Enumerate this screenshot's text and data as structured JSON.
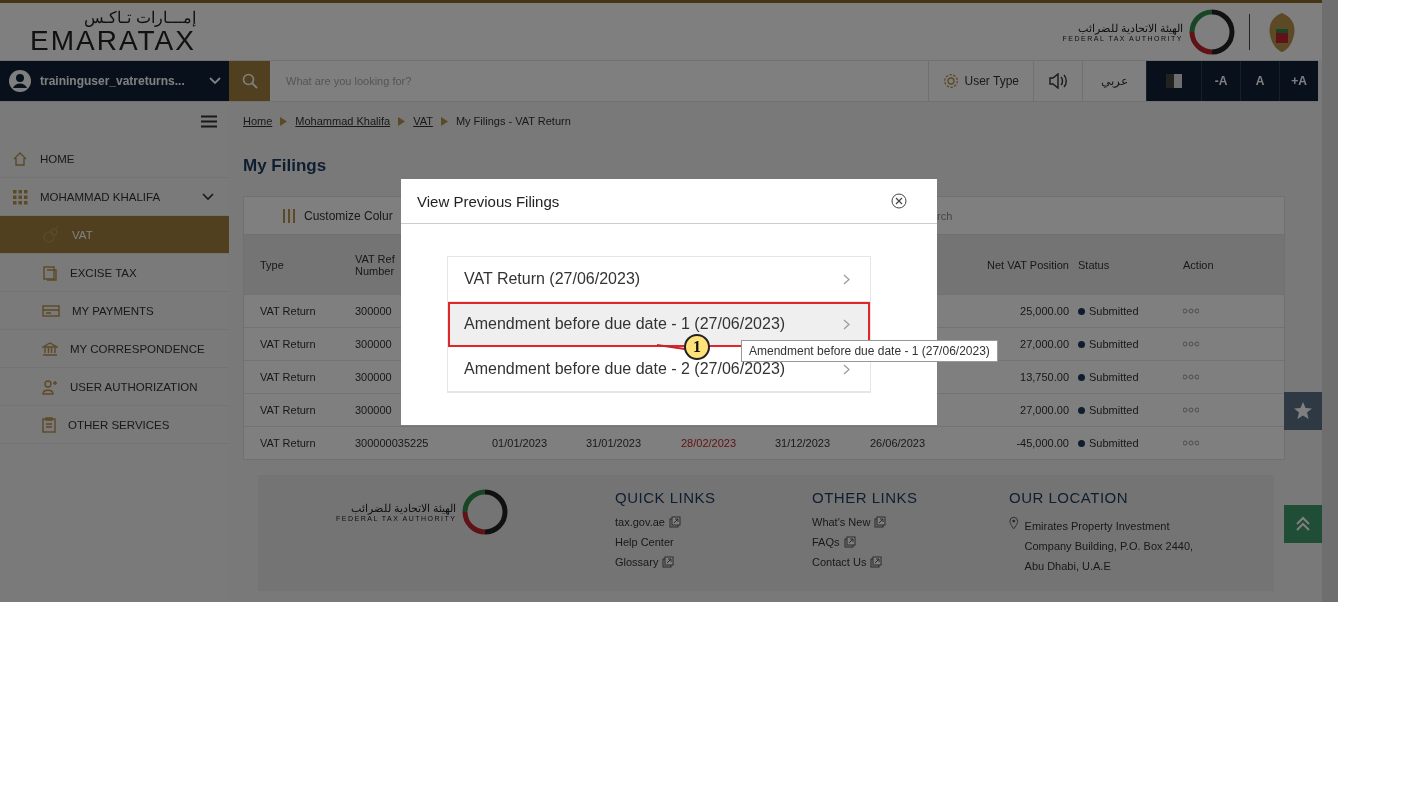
{
  "header": {
    "logo_arabic": "إمـــارات تـاكـس",
    "logo_text": "EMARATAX",
    "authority_arabic": "الهيئة الاتحادية للضرائب",
    "authority_name": "FEDERAL TAX AUTHORITY"
  },
  "navbar": {
    "user": "traininguser_vatreturns...",
    "search": {
      "placeholder": "What are you looking for?"
    },
    "user_type": "User Type",
    "language": "عربي",
    "font_buttons": [
      "-A",
      "A",
      "+A"
    ]
  },
  "breadcrumb": [
    {
      "label": "Home",
      "link": true
    },
    {
      "label": "Mohammad Khalifa",
      "link": true
    },
    {
      "label": "VAT",
      "link": true
    },
    {
      "label": "My Filings - VAT Return",
      "link": false
    }
  ],
  "sidebar": {
    "items": [
      {
        "label": "HOME",
        "selected": false
      },
      {
        "label": "MOHAMMAD KHALIFA",
        "selected": false,
        "expanded": true,
        "children": [
          {
            "label": "VAT",
            "selected": true
          },
          {
            "label": "EXCISE TAX",
            "selected": false
          },
          {
            "label": "MY PAYMENTS",
            "selected": false
          },
          {
            "label": "MY CORRESPONDENCE",
            "selected": false
          },
          {
            "label": "USER AUTHORIZATION",
            "selected": false
          },
          {
            "label": "OTHER SERVICES",
            "selected": false
          }
        ]
      }
    ]
  },
  "page_title": "My Filings",
  "table": {
    "customize": "Customize Colur",
    "search": "rch",
    "columns": [
      "Type",
      "VAT Ref Number",
      "Net VAT Position",
      "Status",
      "Action"
    ],
    "rows": [
      {
        "type": "VAT Return",
        "ref": "300000",
        "net": "25,000.00",
        "status": "Submitted"
      },
      {
        "type": "VAT Return",
        "ref": "300000",
        "net": "27,000.00",
        "status": "Submitted"
      },
      {
        "type": "VAT Return",
        "ref": "300000",
        "net": "13,750.00",
        "status": "Submitted"
      },
      {
        "type": "VAT Return",
        "ref": "300000",
        "net": "27,000.00",
        "status": "Submitted"
      },
      {
        "type": "VAT Return",
        "ref": "300000035225",
        "dates": [
          "01/01/2023",
          "31/01/2023",
          "28/02/2023",
          "31/12/2023",
          "26/06/2023"
        ],
        "due_overdue": true,
        "net": "-45,000.00",
        "status": "Submitted"
      }
    ]
  },
  "footer": {
    "authority_arabic": "الهيئة الاتحادية للضرائب",
    "authority_name": "FEDERAL TAX AUTHORITY",
    "quick_links": {
      "title": "QUICK LINKS",
      "links": [
        {
          "label": "tax.gov.ae",
          "external": true
        },
        {
          "label": "Help Center",
          "external": false
        },
        {
          "label": "Glossary",
          "external": true
        }
      ]
    },
    "other_links": {
      "title": "OTHER LINKS",
      "links": [
        {
          "label": "What's New",
          "external": true
        },
        {
          "label": "FAQs",
          "external": true
        },
        {
          "label": "Contact Us",
          "external": true
        }
      ]
    },
    "location": {
      "title": "OUR LOCATION",
      "address": "Emirates Property Investment Company Building, P.O. Box 2440, Abu Dhabi, U.A.E"
    }
  },
  "modal": {
    "title": "View Previous Filings",
    "items": [
      {
        "label": "VAT Return (27/06/2023)",
        "selected": false
      },
      {
        "label": "Amendment before due date - 1 (27/06/2023)",
        "selected": true
      },
      {
        "label": "Amendment before due date - 2 (27/06/2023)",
        "selected": false
      }
    ]
  },
  "tooltip": "Amendment before due date - 1 (27/06/2023)",
  "callout": "1"
}
